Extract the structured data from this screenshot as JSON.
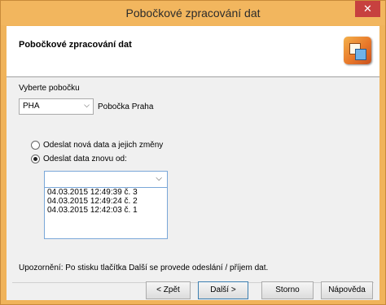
{
  "window": {
    "title": "Pobočkové zpracování dat",
    "close_glyph": "✕"
  },
  "header": {
    "title": "Pobočkové zpracování dat",
    "icon": "wizard-icon"
  },
  "branch": {
    "label": "Vyberte pobočku",
    "code": "PHA",
    "name": "Pobočka Praha"
  },
  "options": {
    "new_data": "Odeslat nová data a jejich změny",
    "resend_from": "Odeslat data znovu od:"
  },
  "resend_list": [
    "04.03.2015  12:49:39  č.  3",
    "04.03.2015  12:49:24  č.  2",
    "04.03.2015  12:42:03  č.  1"
  ],
  "notice": "Upozornění: Po stisku tlačítka Další se provede odeslání / příjem dat.",
  "buttons": {
    "back": "< Zpět",
    "next": "Další >",
    "cancel": "Storno",
    "help": "Nápověda"
  }
}
